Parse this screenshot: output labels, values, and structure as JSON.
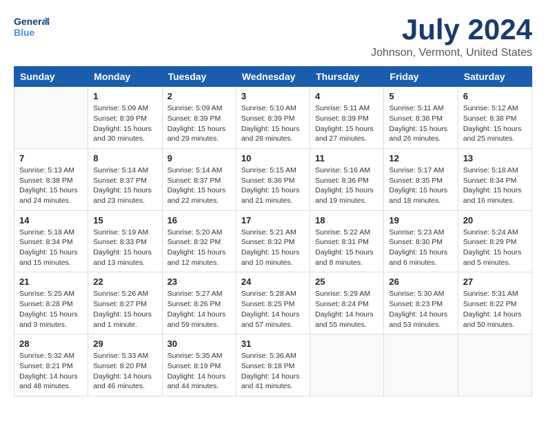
{
  "header": {
    "logo_general": "General",
    "logo_blue": "Blue",
    "title": "July 2024",
    "subtitle": "Johnson, Vermont, United States"
  },
  "days_of_week": [
    "Sunday",
    "Monday",
    "Tuesday",
    "Wednesday",
    "Thursday",
    "Friday",
    "Saturday"
  ],
  "weeks": [
    [
      {
        "day": "",
        "info": ""
      },
      {
        "day": "1",
        "info": "Sunrise: 5:09 AM\nSunset: 8:39 PM\nDaylight: 15 hours\nand 30 minutes."
      },
      {
        "day": "2",
        "info": "Sunrise: 5:09 AM\nSunset: 8:39 PM\nDaylight: 15 hours\nand 29 minutes."
      },
      {
        "day": "3",
        "info": "Sunrise: 5:10 AM\nSunset: 8:39 PM\nDaylight: 15 hours\nand 28 minutes."
      },
      {
        "day": "4",
        "info": "Sunrise: 5:11 AM\nSunset: 8:39 PM\nDaylight: 15 hours\nand 27 minutes."
      },
      {
        "day": "5",
        "info": "Sunrise: 5:11 AM\nSunset: 8:38 PM\nDaylight: 15 hours\nand 26 minutes."
      },
      {
        "day": "6",
        "info": "Sunrise: 5:12 AM\nSunset: 8:38 PM\nDaylight: 15 hours\nand 25 minutes."
      }
    ],
    [
      {
        "day": "7",
        "info": "Sunrise: 5:13 AM\nSunset: 8:38 PM\nDaylight: 15 hours\nand 24 minutes."
      },
      {
        "day": "8",
        "info": "Sunrise: 5:14 AM\nSunset: 8:37 PM\nDaylight: 15 hours\nand 23 minutes."
      },
      {
        "day": "9",
        "info": "Sunrise: 5:14 AM\nSunset: 8:37 PM\nDaylight: 15 hours\nand 22 minutes."
      },
      {
        "day": "10",
        "info": "Sunrise: 5:15 AM\nSunset: 8:36 PM\nDaylight: 15 hours\nand 21 minutes."
      },
      {
        "day": "11",
        "info": "Sunrise: 5:16 AM\nSunset: 8:36 PM\nDaylight: 15 hours\nand 19 minutes."
      },
      {
        "day": "12",
        "info": "Sunrise: 5:17 AM\nSunset: 8:35 PM\nDaylight: 15 hours\nand 18 minutes."
      },
      {
        "day": "13",
        "info": "Sunrise: 5:18 AM\nSunset: 8:34 PM\nDaylight: 15 hours\nand 16 minutes."
      }
    ],
    [
      {
        "day": "14",
        "info": "Sunrise: 5:18 AM\nSunset: 8:34 PM\nDaylight: 15 hours\nand 15 minutes."
      },
      {
        "day": "15",
        "info": "Sunrise: 5:19 AM\nSunset: 8:33 PM\nDaylight: 15 hours\nand 13 minutes."
      },
      {
        "day": "16",
        "info": "Sunrise: 5:20 AM\nSunset: 8:32 PM\nDaylight: 15 hours\nand 12 minutes."
      },
      {
        "day": "17",
        "info": "Sunrise: 5:21 AM\nSunset: 8:32 PM\nDaylight: 15 hours\nand 10 minutes."
      },
      {
        "day": "18",
        "info": "Sunrise: 5:22 AM\nSunset: 8:31 PM\nDaylight: 15 hours\nand 8 minutes."
      },
      {
        "day": "19",
        "info": "Sunrise: 5:23 AM\nSunset: 8:30 PM\nDaylight: 15 hours\nand 6 minutes."
      },
      {
        "day": "20",
        "info": "Sunrise: 5:24 AM\nSunset: 8:29 PM\nDaylight: 15 hours\nand 5 minutes."
      }
    ],
    [
      {
        "day": "21",
        "info": "Sunrise: 5:25 AM\nSunset: 8:28 PM\nDaylight: 15 hours\nand 3 minutes."
      },
      {
        "day": "22",
        "info": "Sunrise: 5:26 AM\nSunset: 8:27 PM\nDaylight: 15 hours\nand 1 minute."
      },
      {
        "day": "23",
        "info": "Sunrise: 5:27 AM\nSunset: 8:26 PM\nDaylight: 14 hours\nand 59 minutes."
      },
      {
        "day": "24",
        "info": "Sunrise: 5:28 AM\nSunset: 8:25 PM\nDaylight: 14 hours\nand 57 minutes."
      },
      {
        "day": "25",
        "info": "Sunrise: 5:29 AM\nSunset: 8:24 PM\nDaylight: 14 hours\nand 55 minutes."
      },
      {
        "day": "26",
        "info": "Sunrise: 5:30 AM\nSunset: 8:23 PM\nDaylight: 14 hours\nand 53 minutes."
      },
      {
        "day": "27",
        "info": "Sunrise: 5:31 AM\nSunset: 8:22 PM\nDaylight: 14 hours\nand 50 minutes."
      }
    ],
    [
      {
        "day": "28",
        "info": "Sunrise: 5:32 AM\nSunset: 8:21 PM\nDaylight: 14 hours\nand 48 minutes."
      },
      {
        "day": "29",
        "info": "Sunrise: 5:33 AM\nSunset: 8:20 PM\nDaylight: 14 hours\nand 46 minutes."
      },
      {
        "day": "30",
        "info": "Sunrise: 5:35 AM\nSunset: 8:19 PM\nDaylight: 14 hours\nand 44 minutes."
      },
      {
        "day": "31",
        "info": "Sunrise: 5:36 AM\nSunset: 8:18 PM\nDaylight: 14 hours\nand 41 minutes."
      },
      {
        "day": "",
        "info": ""
      },
      {
        "day": "",
        "info": ""
      },
      {
        "day": "",
        "info": ""
      }
    ]
  ]
}
